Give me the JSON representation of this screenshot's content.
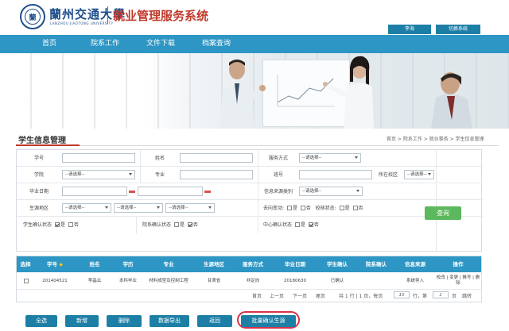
{
  "header": {
    "university_name": "蘭州交通大學",
    "university_sub": "LANZHOU JIAOTONG UNIVERSITY",
    "system_title": "就业管理服务系统",
    "user_name": "李海",
    "switch_label": "切换系统"
  },
  "nav": {
    "items": [
      {
        "label": "首页"
      },
      {
        "label": "院系工作"
      },
      {
        "label": "文件下载"
      },
      {
        "label": "档案查询"
      }
    ]
  },
  "section": {
    "title": "学生信息管理",
    "breadcrumb": "首页 > 院系工作 > 就业事务 > 学生信息管理"
  },
  "form": {
    "student_id_label": "学号",
    "name_label": "姓名",
    "service_mode_label": "服务方式",
    "service_mode_value": "--请选择--",
    "college_label": "学院",
    "college_value": "--请选择--",
    "major_label": "专业",
    "class_label": "班号",
    "campus_label": "所在校区",
    "campus_value": "--请选择--",
    "grad_date_label": "毕业日期",
    "info_source_label": "信息来源类别",
    "info_source_value": "--请选择--",
    "origin_label": "生源地区",
    "origin_value_1": "--请选择--",
    "origin_value_2": "--请选择--",
    "origin_value_3": "--请选择--",
    "destination_label": "去向变动:",
    "dest_yes": "是",
    "dest_no": "否",
    "verify_status_label": "校核状态:",
    "verify_yes": "是",
    "verify_no": "否",
    "student_confirm_label": "学生确认状态",
    "student_yes": "是",
    "student_no": "否",
    "dept_confirm_label": "院系确认状态",
    "dept_yes": "是",
    "dept_no": "否",
    "center_confirm_label": "中心确认状态",
    "center_yes": "是",
    "center_no": "否",
    "query_label": "查询",
    "checkboxes": {
      "dest_yes": false,
      "dest_no": false,
      "verify_yes": false,
      "verify_no": false,
      "student_yes": true,
      "student_no": false,
      "dept_yes": false,
      "dept_no": true,
      "center_yes": false,
      "center_no": true
    }
  },
  "table": {
    "headers": [
      "选择",
      "学号",
      "姓名",
      "学历",
      "专业",
      "生源地区",
      "服务方式",
      "毕业日期",
      "学生确认",
      "院系确认",
      "信息来源",
      "操作"
    ],
    "sort_icon": "sort-up-icon",
    "rows": [
      {
        "student_id": "201404521",
        "name": "李晶云",
        "education": "本科毕业",
        "major": "材料成型及控制工程",
        "origin": "甘肃省",
        "service": "非定向",
        "grad_date": "20180630",
        "student_confirm": "已确认",
        "dept_confirm": "",
        "source": "系统导入",
        "actions": "校改 | 变更 | 推号 | 删除"
      }
    ],
    "pager": {
      "first": "首页",
      "prev": "上一页",
      "next": "下一页",
      "last": "尾页",
      "summary": "共 1 行 | 1 页，每页",
      "page_size": "10",
      "unit_rows": "行，第",
      "current_page": "1",
      "unit_page": "页",
      "jump": "跳转"
    }
  },
  "actions": {
    "select_all": "全选",
    "add": "新增",
    "delete": "删除",
    "export": "数据导出",
    "back": "返回",
    "batch_confirm": "批量确认生源"
  },
  "colors": {
    "nav_blue": "#2d96c4",
    "btn_blue": "#1e7fa6",
    "title_red": "#c0392b",
    "query_green": "#5cb85c",
    "highlight_red": "#d8334a"
  }
}
